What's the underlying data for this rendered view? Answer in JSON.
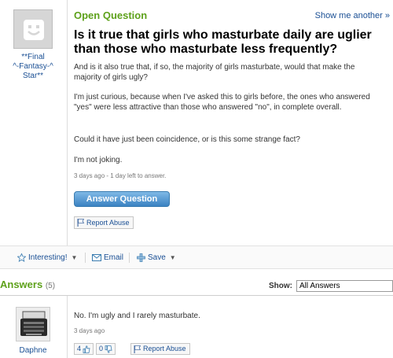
{
  "asker": {
    "name": "**Final\n^-Fantasy-^\nStar**",
    "avatar_icon": "smiley-face-icon"
  },
  "question": {
    "type_label": "Open Question",
    "show_another": "Show me another »",
    "title": "Is it true that girls who masturbate daily are uglier than those who masturbate less frequently?",
    "details": [
      "And is it also true that, if so, the majority of girls masturbate, would that make the majority of girls ugly?",
      "I'm just curious, because when I've asked this to girls before, the ones who answered \"yes\" were less attractive than those who answered \"no\", in complete overall.",
      "Could it have just been coincidence, or is this some strange fact?",
      "I'm not joking."
    ],
    "meta": "3 days ago - 1 day left to answer.",
    "answer_button": "Answer Question",
    "report_abuse": "Report Abuse"
  },
  "toolbar": {
    "interesting": "Interesting!",
    "email": "Email",
    "save": "Save"
  },
  "answers": {
    "heading": "Answers",
    "count": "(5)",
    "show_label": "Show:",
    "show_value": "All Answers",
    "items": [
      {
        "author": "Daphne",
        "avatar_icon": "typewriter-icon",
        "text": "No. I'm ugly and I rarely masturbate.",
        "meta": "3 days ago",
        "thumbs_up": "4",
        "thumbs_down": "0",
        "report_abuse": "Report Abuse"
      }
    ]
  },
  "colors": {
    "accent_green": "#5ea11b",
    "link_blue": "#1a4f94",
    "button_blue": "#3b82c2"
  }
}
